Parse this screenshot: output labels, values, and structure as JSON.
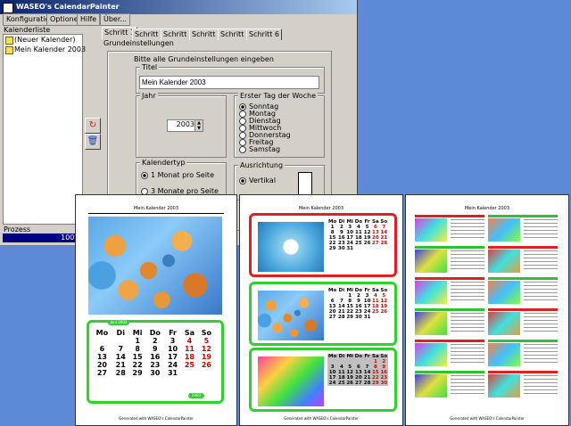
{
  "window": {
    "title": "WASEO's CalendarPainter",
    "menus": [
      "Konfiguration",
      "Optionen",
      "Hilfe",
      "Über..."
    ]
  },
  "sidebar": {
    "calendars_label": "Kalenderliste",
    "items": [
      "(Neuer Kalender)",
      "Mein Kalender 2003"
    ],
    "progress_label": "Prozess",
    "progress_value": "100%",
    "progress_fraction": 1.0
  },
  "tabs": [
    "Schritt 1",
    "Schritt 2",
    "Schritt 3",
    "Schritt 4",
    "Schritt 5",
    "Schritt 6"
  ],
  "form": {
    "section": "Grundeinstellungen",
    "intro": "Bitte alle Grundeinstellungen eingeben",
    "title_label": "Titel",
    "title_value": "Mein Kalender 2003",
    "year_label": "Jahr",
    "year_value": "2003",
    "weekstart_label": "Erster Tag der Woche",
    "weekdays": [
      "Sonntag",
      "Montag",
      "Dienstag",
      "Mittwoch",
      "Donnerstag",
      "Freitag",
      "Samstag"
    ],
    "weekstart_selected": "Sonntag",
    "type_label": "Kalendertyp",
    "types": [
      "1 Monat pro Seite",
      "3 Monate pro Seite"
    ],
    "orientation_label": "Ausrichtung",
    "orientation_value": "Vertikal"
  },
  "previews": {
    "page_title": "Mein Kalender 2003",
    "footer": "Generated with WASEO's CalendarPainter",
    "weekday_headers": [
      "Mo",
      "Di",
      "Mi",
      "Do",
      "Fr",
      "Sa",
      "So"
    ],
    "page1": {
      "month_pill": "Juni 2003",
      "year_pill": "2003",
      "rows": [
        [
          "",
          "",
          "",
          "",
          "",
          "",
          "1"
        ],
        [
          "2",
          "3",
          "4",
          "5",
          "6",
          "7",
          "8"
        ],
        [
          "9",
          "10",
          "11",
          "12",
          "13",
          "14",
          "15"
        ],
        [
          "16",
          "17",
          "18",
          "19",
          "20",
          "21",
          "22"
        ],
        [
          "23",
          "24",
          "25",
          "26",
          "27",
          "28",
          "29"
        ],
        [
          "30",
          "",
          "",
          "",
          "",
          "",
          ""
        ]
      ],
      "rows_shown": [
        [
          "",
          "",
          "1",
          "2",
          "3",
          "4",
          "5"
        ],
        [
          "6",
          "7",
          "8",
          "9",
          "10",
          "11",
          "12"
        ],
        [
          "13",
          "14",
          "15",
          "16",
          "17",
          "18",
          "19"
        ],
        [
          "20",
          "21",
          "22",
          "23",
          "24",
          "25",
          "26"
        ],
        [
          "27",
          "28",
          "29",
          "30",
          "31",
          "",
          ""
        ]
      ]
    },
    "page2": {
      "blocks": [
        {
          "month": "Dezember 2003",
          "rows": [
            [
              "1",
              "2",
              "3",
              "4",
              "5",
              "6",
              "7"
            ],
            [
              "8",
              "9",
              "10",
              "11",
              "12",
              "13",
              "14"
            ],
            [
              "15",
              "16",
              "17",
              "18",
              "19",
              "20",
              "21"
            ],
            [
              "22",
              "23",
              "24",
              "25",
              "26",
              "27",
              "28"
            ],
            [
              "29",
              "30",
              "31",
              "",
              "",
              "",
              ""
            ]
          ]
        },
        {
          "month": "Oktober 2003",
          "rows": [
            [
              "",
              "",
              "1",
              "2",
              "3",
              "4",
              "5"
            ],
            [
              "6",
              "7",
              "8",
              "9",
              "10",
              "11",
              "12"
            ],
            [
              "13",
              "14",
              "15",
              "16",
              "17",
              "18",
              "19"
            ],
            [
              "20",
              "21",
              "22",
              "23",
              "24",
              "25",
              "26"
            ],
            [
              "27",
              "28",
              "29",
              "30",
              "31",
              "",
              ""
            ]
          ]
        },
        {
          "month": "November 2003",
          "rows": [
            [
              "",
              "",
              "",
              "",
              "",
              "1",
              "2"
            ],
            [
              "3",
              "4",
              "5",
              "6",
              "7",
              "8",
              "9"
            ],
            [
              "10",
              "11",
              "12",
              "13",
              "14",
              "15",
              "16"
            ],
            [
              "17",
              "18",
              "19",
              "20",
              "21",
              "22",
              "23"
            ],
            [
              "24",
              "25",
              "26",
              "27",
              "28",
              "29",
              "30"
            ]
          ]
        }
      ]
    },
    "page3": {
      "thumb_colors": [
        "#e02020",
        "#30c030",
        "#30c030",
        "#e02020",
        "#e02020",
        "#30c030",
        "#30c030",
        "#e02020",
        "#e02020",
        "#30c030",
        "#30c030",
        "#e02020"
      ]
    }
  }
}
